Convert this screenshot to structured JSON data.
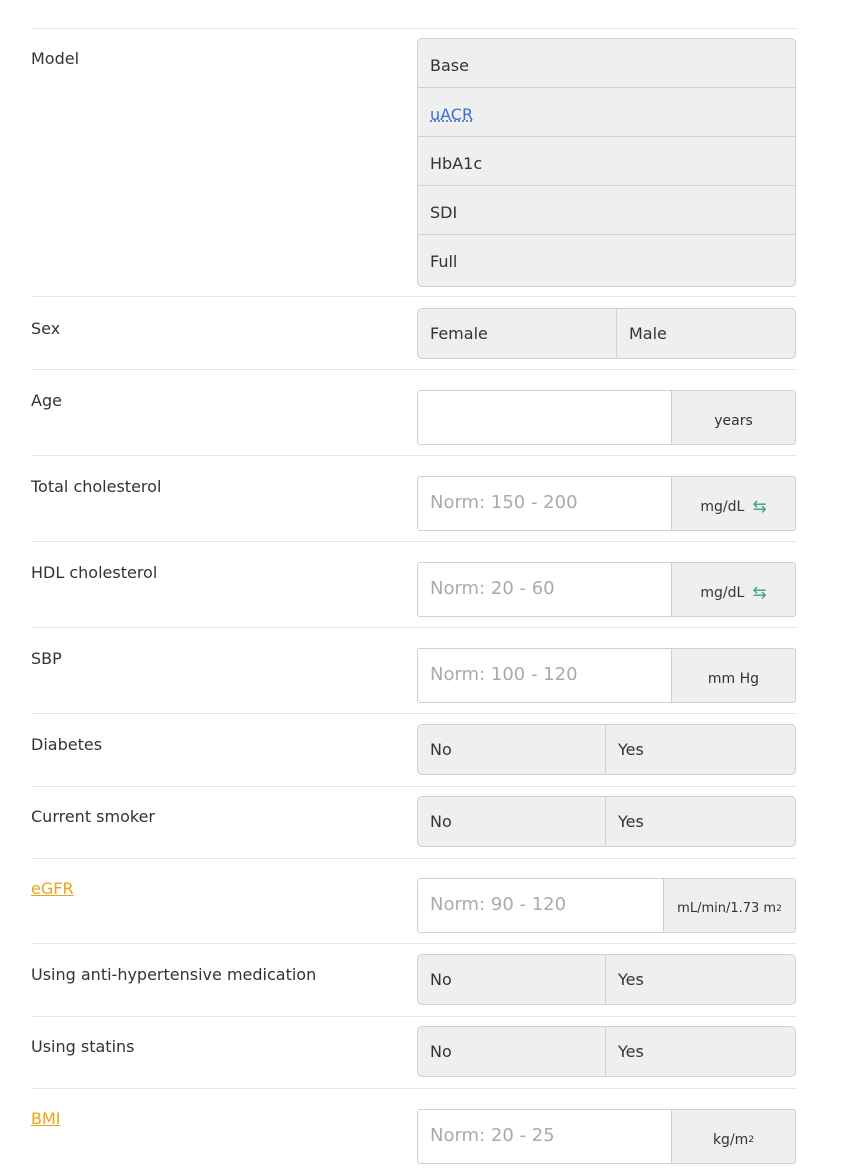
{
  "model": {
    "label": "Model",
    "options": [
      "Base",
      "uACR",
      "HbA1c",
      "SDI",
      "Full"
    ]
  },
  "sex": {
    "label": "Sex",
    "options": [
      "Female",
      "Male"
    ]
  },
  "age": {
    "label": "Age",
    "placeholder": "",
    "unit": "years"
  },
  "total_cholesterol": {
    "label": "Total cholesterol",
    "placeholder": "Norm: 150 - 200",
    "unit": "mg/dL",
    "unit_icon": "swap-arrows-icon"
  },
  "hdl_cholesterol": {
    "label": "HDL cholesterol",
    "placeholder": "Norm: 20 - 60",
    "unit": "mg/dL",
    "unit_icon": "swap-arrows-icon"
  },
  "sbp": {
    "label": "SBP",
    "placeholder": "Norm: 100 - 120",
    "unit": "mm Hg"
  },
  "diabetes": {
    "label": "Diabetes",
    "options": [
      "No",
      "Yes"
    ]
  },
  "smoker": {
    "label": "Current smoker",
    "options": [
      "No",
      "Yes"
    ]
  },
  "egfr": {
    "label": "eGFR",
    "placeholder": "Norm: 90 - 120",
    "unit": "mL/min/1.73 m",
    "unit_sup": "2"
  },
  "antihypertensive": {
    "label": "Using anti-hypertensive medication",
    "options": [
      "No",
      "Yes"
    ]
  },
  "statins": {
    "label": "Using statins",
    "options": [
      "No",
      "Yes"
    ]
  },
  "bmi": {
    "label": "BMI",
    "placeholder": "Norm: 20 - 25",
    "unit": "kg/m",
    "unit_sup": "2"
  },
  "colors": {
    "link": "#e8a317",
    "abbr": "#3b6fcf",
    "swap": "#3aa57a",
    "control_bg": "#efefef"
  }
}
